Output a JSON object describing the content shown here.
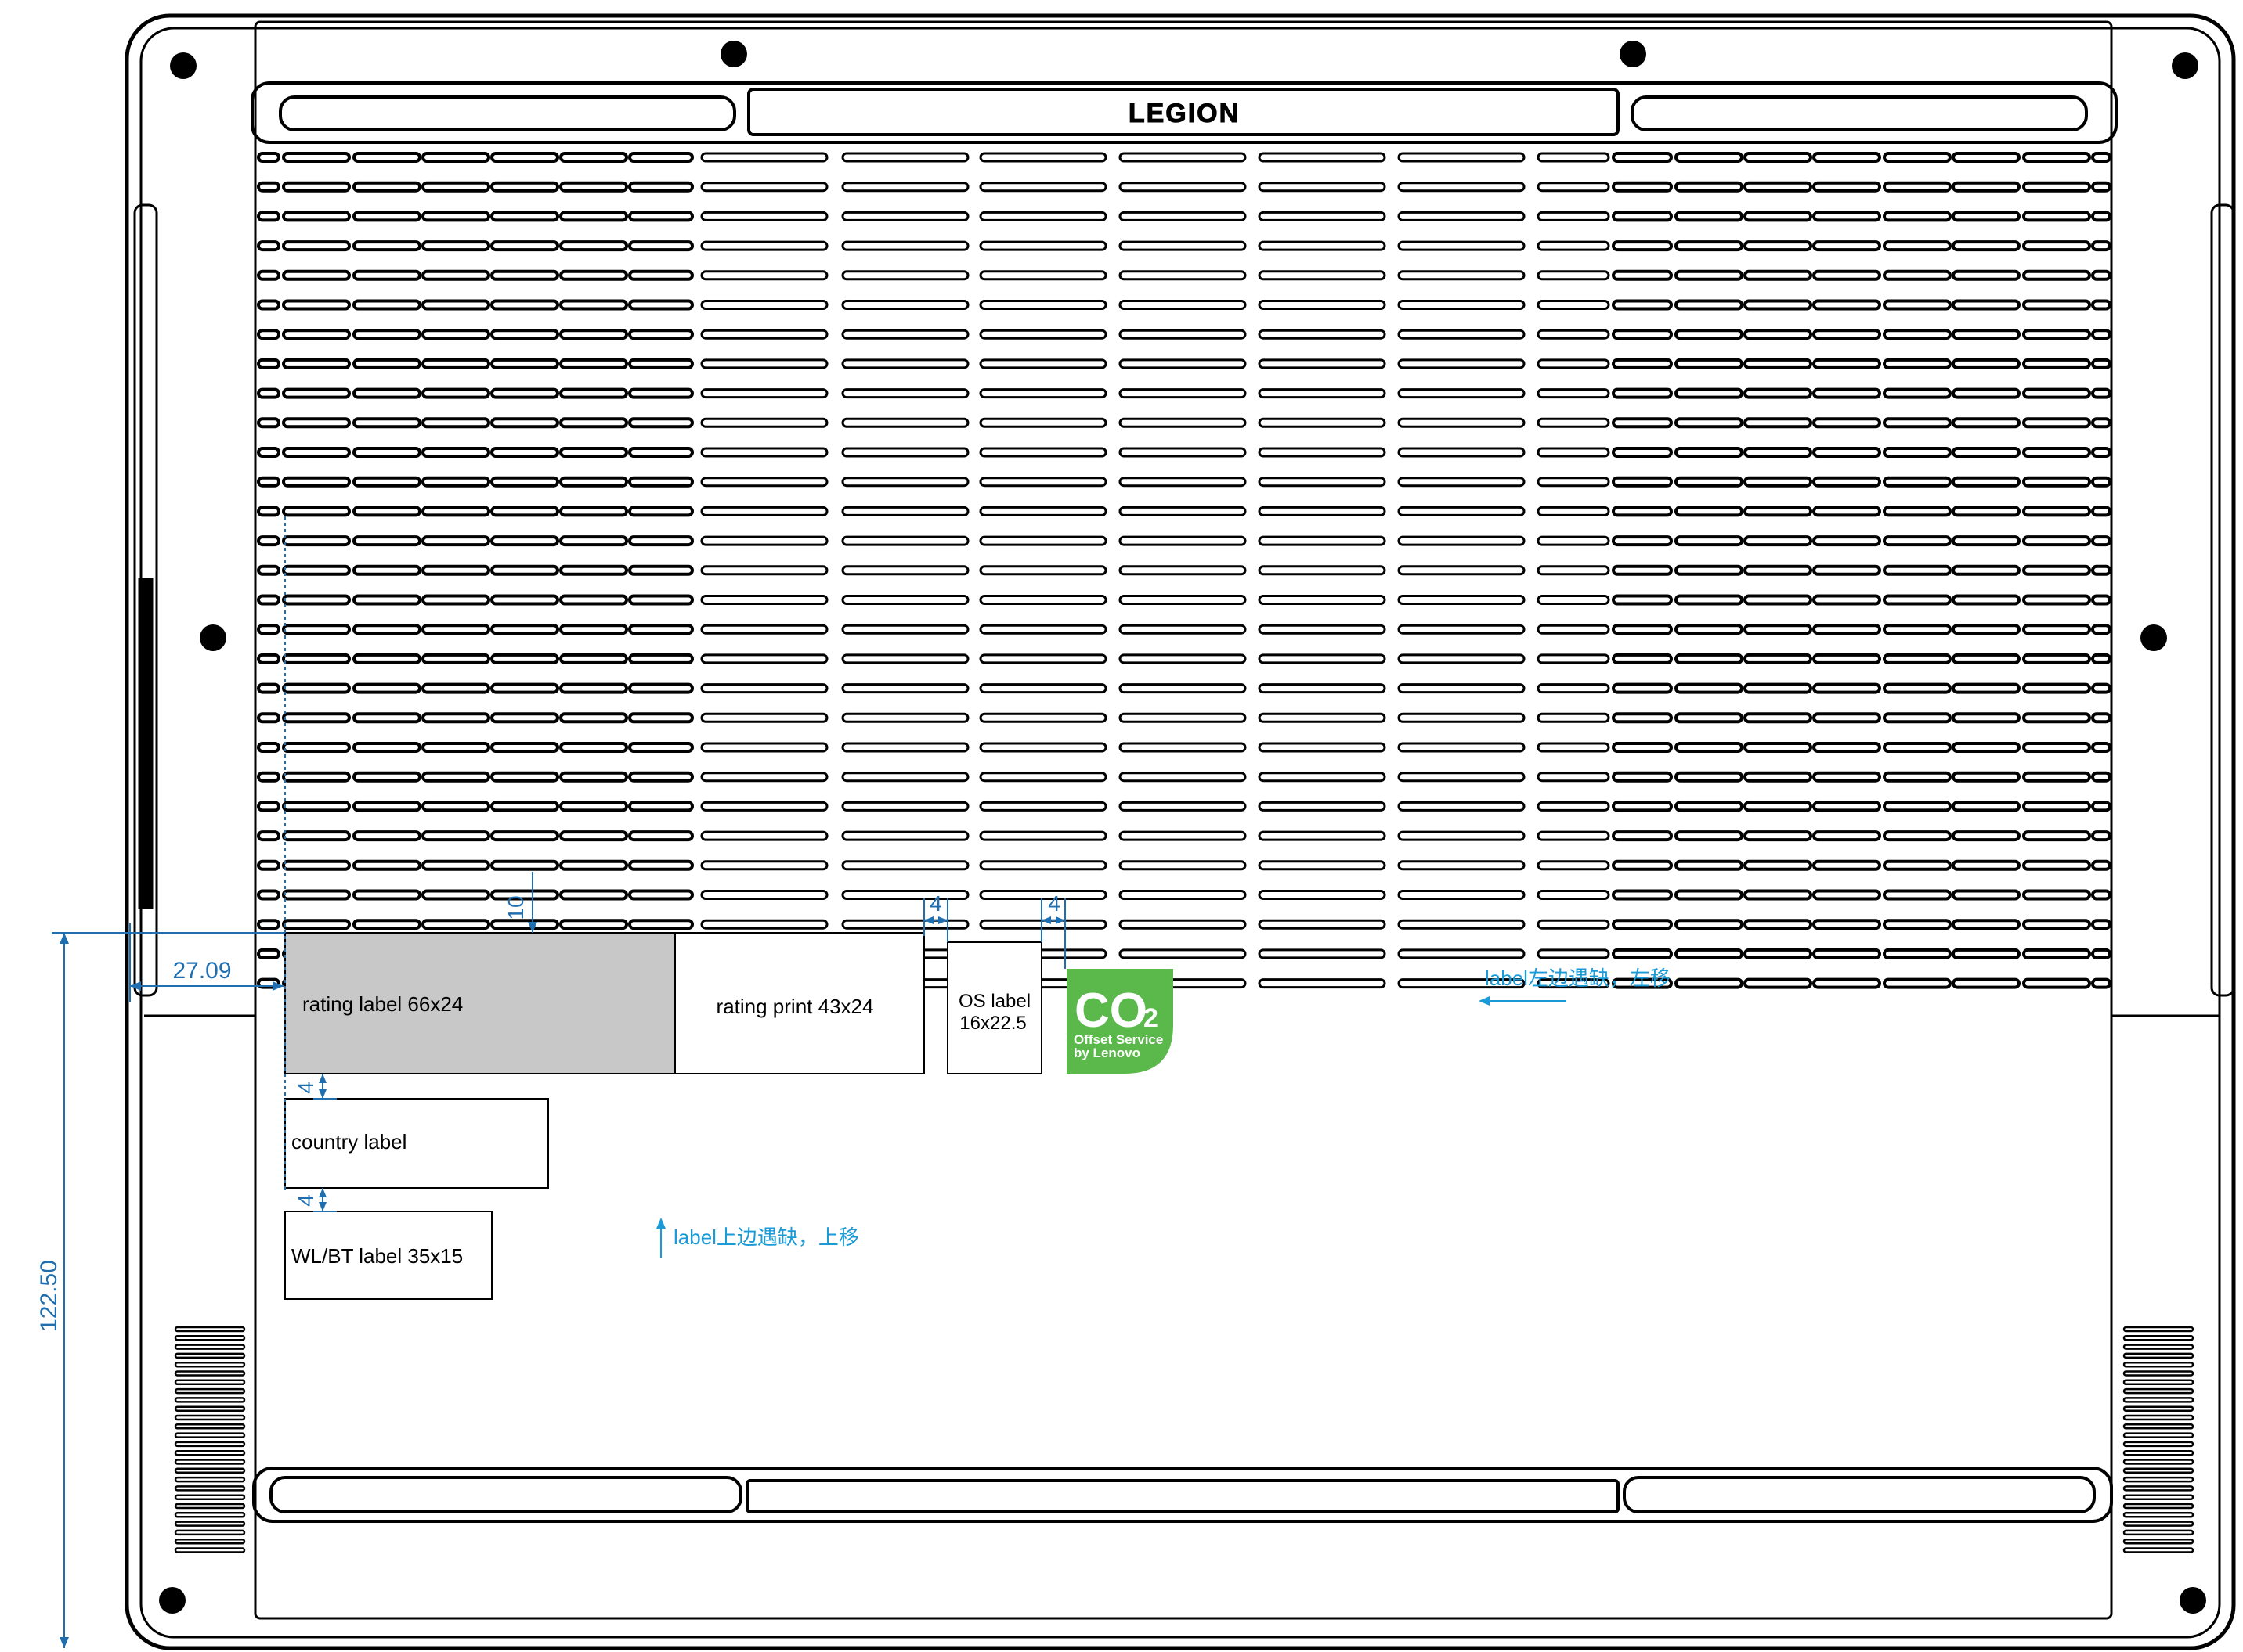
{
  "brand": "LEGION",
  "labels": {
    "rating_label": "rating label 66x24",
    "rating_print": "rating print 43x24",
    "os_label_line1": "OS label",
    "os_label_line2": "16x22.5",
    "country_label": "country label",
    "wlbt_label": "WL/BT label 35x15"
  },
  "co2_badge": {
    "symbol": "CO",
    "subscript": "2",
    "line1": "Offset Service",
    "line2": "by Lenovo",
    "color": "#5ab94a"
  },
  "dimensions": {
    "top_gap": "10",
    "gap_left": "4",
    "gap_right": "4",
    "gap_country": "4",
    "gap_wlbt": "4",
    "left_offset": "27.09",
    "total_height": "122.50"
  },
  "notes": {
    "move_left": "label左边遇缺，左移",
    "move_up": "label上边遇缺，上移"
  },
  "colors": {
    "outline": "#000000",
    "dimension": "#1f6fb0",
    "note": "#1a9ad6",
    "rating_fill": "#c8c8c8"
  }
}
